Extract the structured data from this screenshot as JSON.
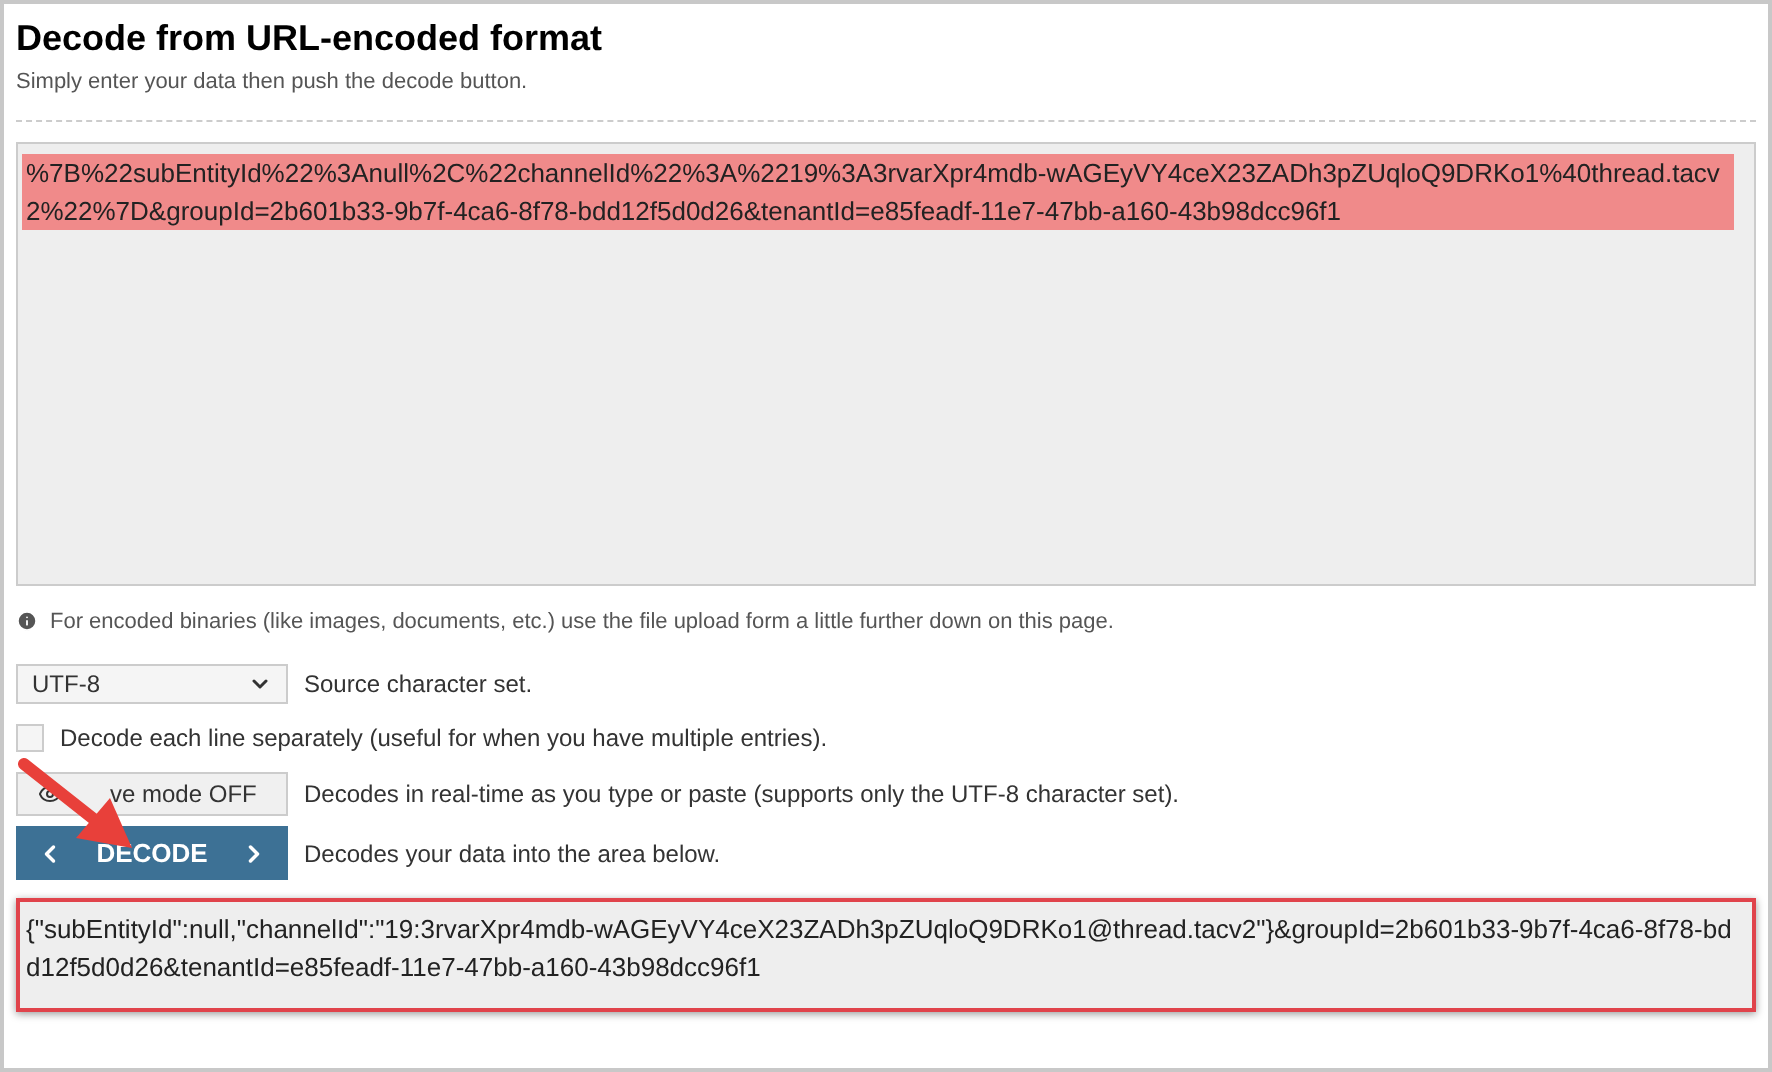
{
  "title": "Decode from URL-encoded format",
  "subtitle": "Simply enter your data then push the decode button.",
  "input": {
    "value": "%7B%22subEntityId%22%3Anull%2C%22channelId%22%3A%2219%3A3rvarXpr4mdb-wAGEyVY4ceX23ZADh3pZUqloQ9DRKo1%40thread.tacv2%22%7D&groupId=2b601b33-9b7f-4ca6-8f78-bdd12f5d0d26&tenantId=e85feadf-11e7-47bb-a160-43b98dcc96f1",
    "highlighted": true
  },
  "info": "For encoded binaries (like images, documents, etc.) use the file upload form a little further down on this page.",
  "charset": {
    "value": "UTF-8",
    "label": "Source character set."
  },
  "separate_lines": {
    "checked": false,
    "label": "Decode each line separately (useful for when you have multiple entries)."
  },
  "live_mode": {
    "button": "ve mode OFF",
    "label": "Decodes in real-time as you type or paste (supports only the UTF-8 character set)."
  },
  "decode": {
    "button": "DECODE",
    "label": "Decodes your data into the area below."
  },
  "output": {
    "value": "{\"subEntityId\":null,\"channelId\":\"19:3rvarXpr4mdb-wAGEyVY4ceX23ZADh3pZUqloQ9DRKo1@thread.tacv2\"}&groupId=2b601b33-9b7f-4ca6-8f78-bdd12f5d0d26&tenantId=e85feadf-11e7-47bb-a160-43b98dcc96f1",
    "outlined": true
  }
}
